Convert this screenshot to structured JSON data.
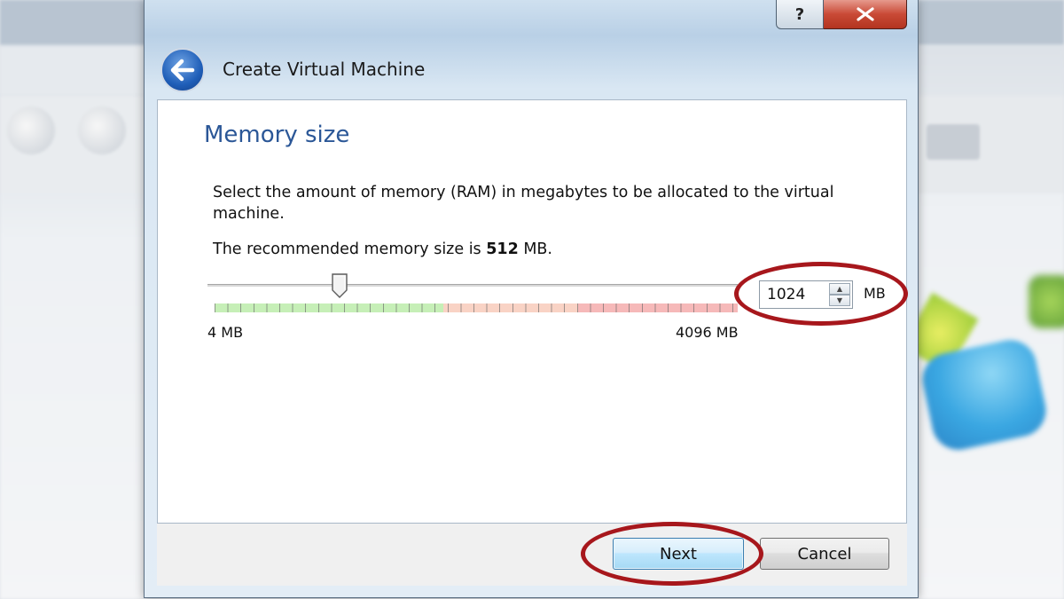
{
  "window": {
    "title": "Create Virtual Machine",
    "help_icon_glyph": "?",
    "close_icon_glyph": "✕"
  },
  "page": {
    "heading": "Memory size",
    "description": "Select the amount of memory (RAM) in megabytes to be allocated to the virtual machine.",
    "recommend_prefix": "The recommended memory size is ",
    "recommend_value": "512",
    "recommend_suffix": " MB."
  },
  "memory": {
    "value": "1024",
    "unit": "MB",
    "min_label": "4 MB",
    "max_label": "4096 MB",
    "min_mb": 4,
    "max_mb": 4096,
    "slider_value_mb": 1024
  },
  "buttons": {
    "next": "Next",
    "cancel": "Cancel"
  },
  "colors": {
    "heading": "#2b5797",
    "highlight_ring": "#a7171c",
    "zone_green": "#c6efb7",
    "zone_orange": "#f9d3c5",
    "zone_red": "#f6b9b9"
  },
  "icons": {
    "back": "back-arrow-icon",
    "help": "help-icon",
    "close": "close-icon",
    "spin_up": "chevron-up-icon",
    "spin_down": "chevron-down-icon",
    "slider_thumb": "slider-thumb-icon"
  }
}
